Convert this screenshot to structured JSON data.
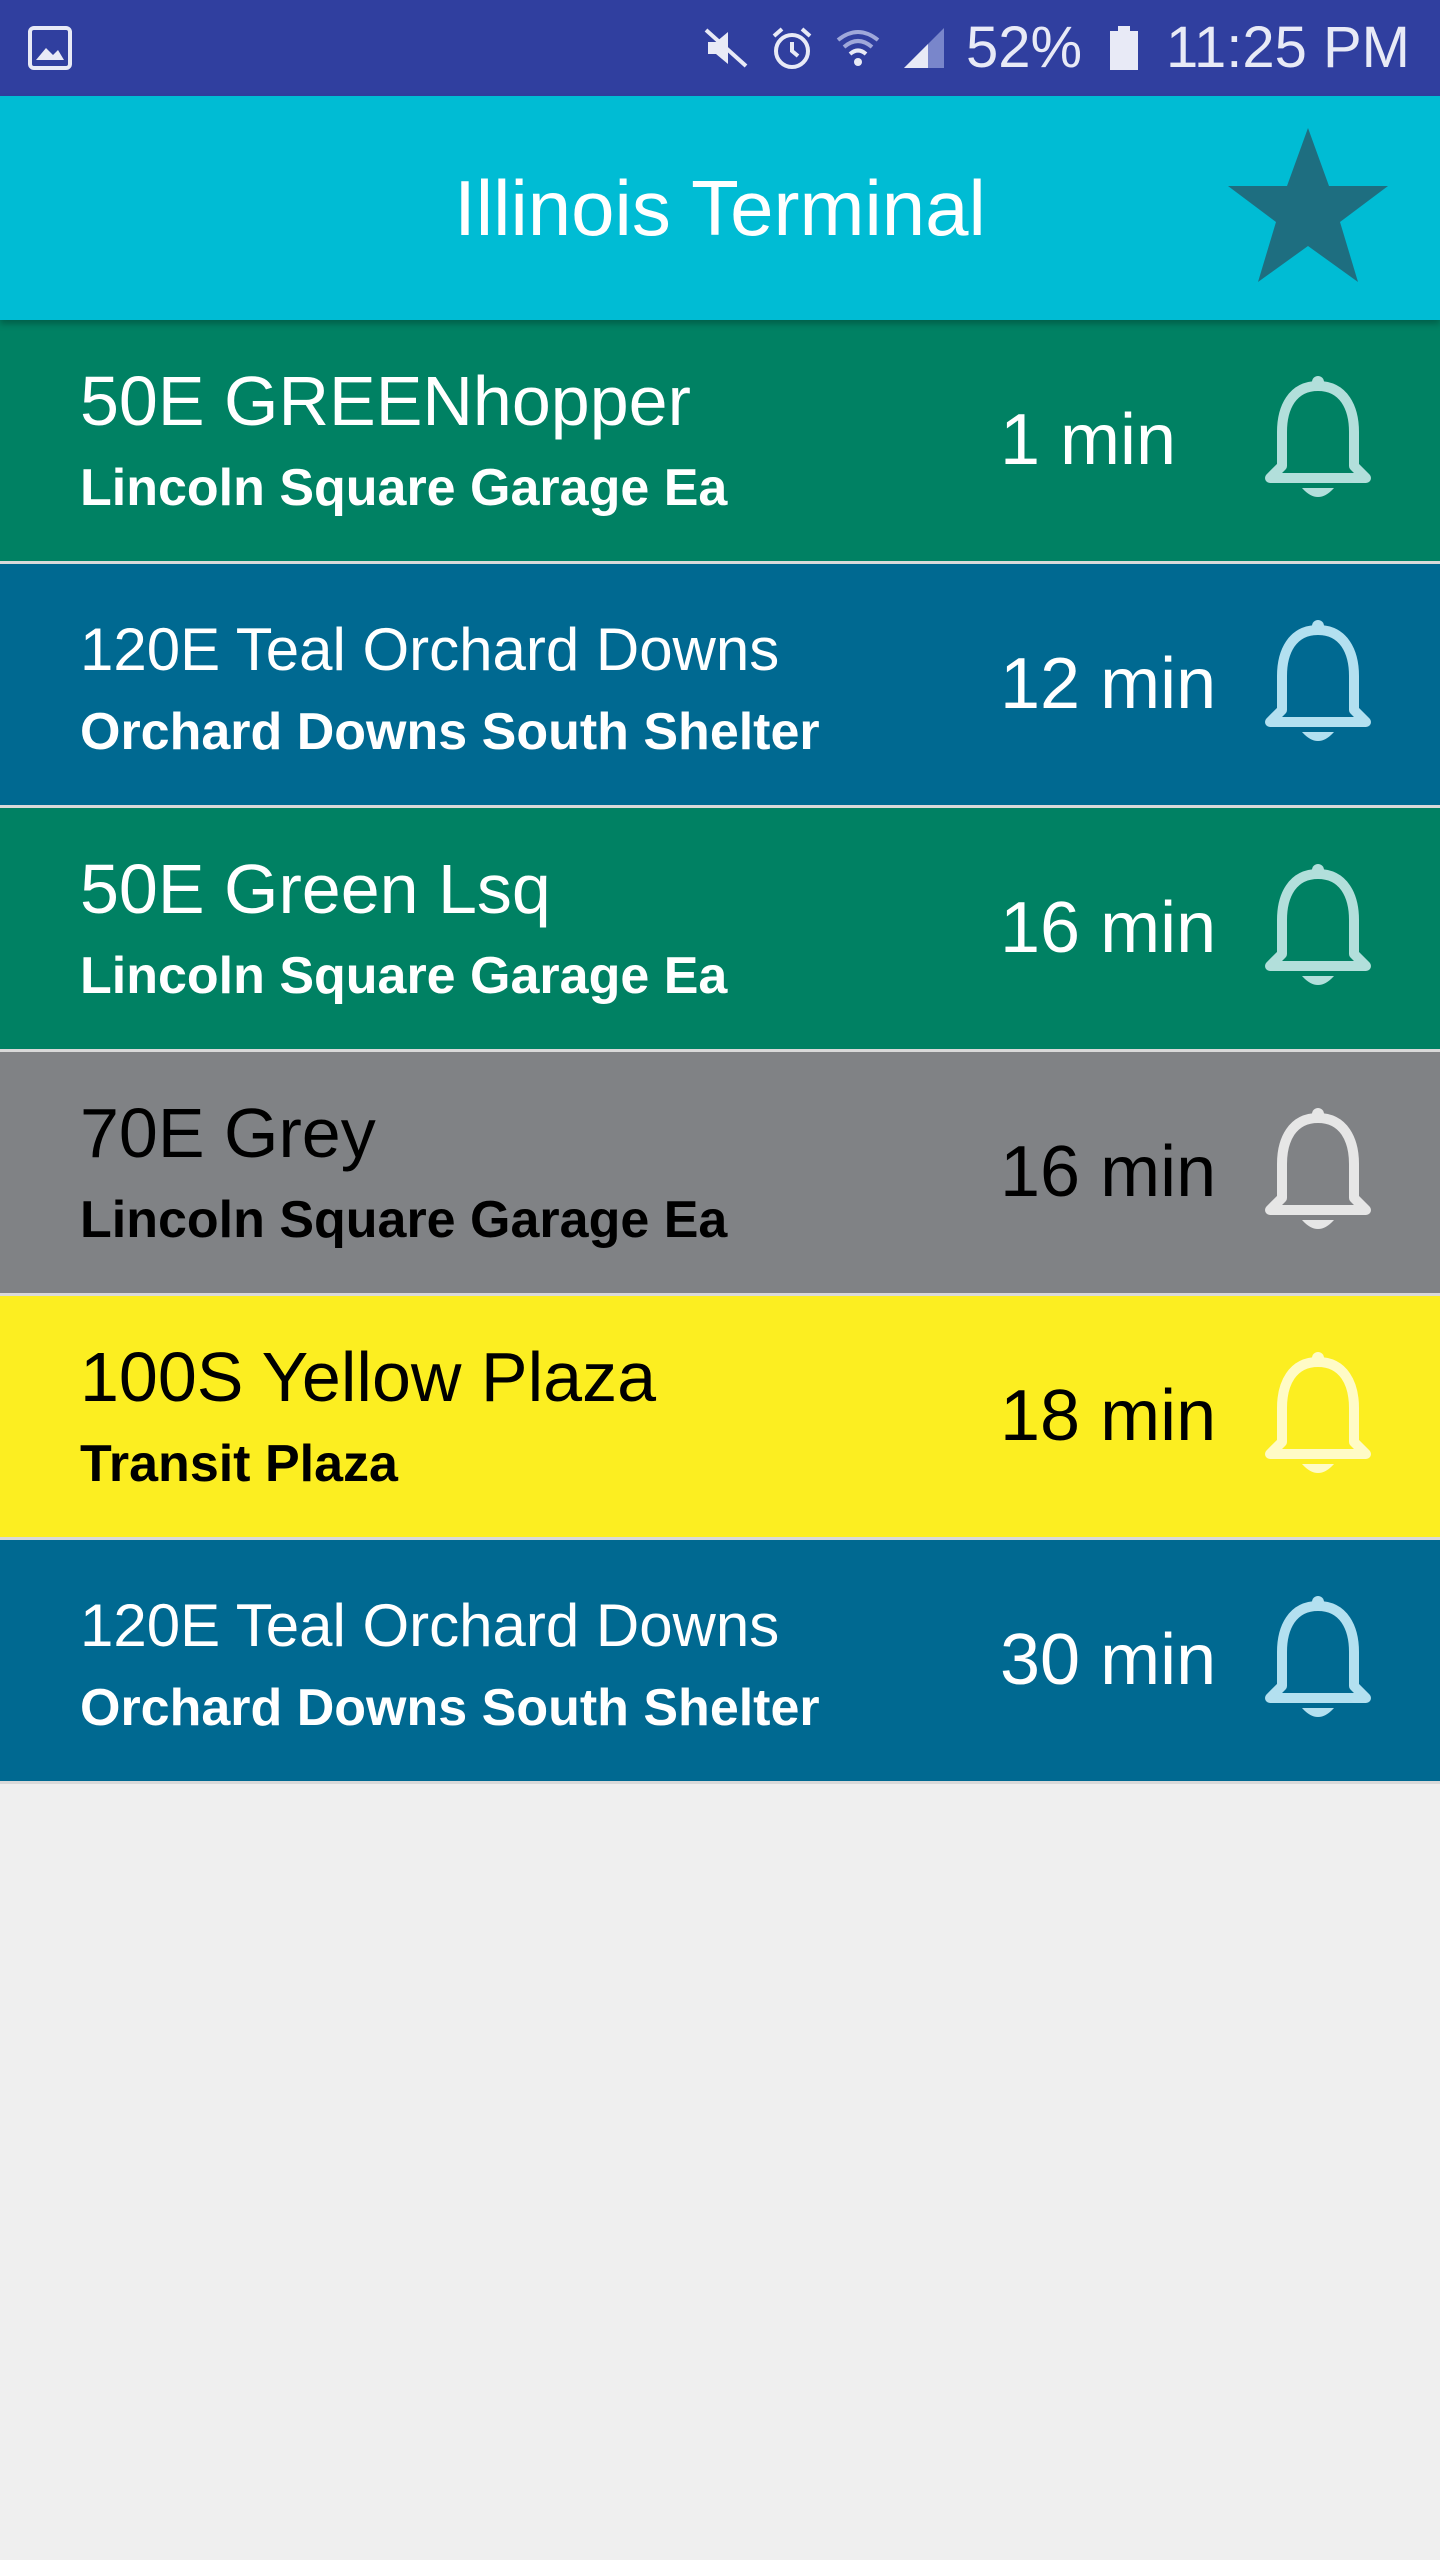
{
  "status_bar": {
    "left_icon": "gallery-notification-icon",
    "icons": [
      "mute-icon",
      "alarm-icon",
      "wifi-icon",
      "signal-icon"
    ],
    "battery": "52%",
    "time": "11:25 PM"
  },
  "header": {
    "title": "Illinois Terminal",
    "favorite_icon": "star-icon"
  },
  "departures": [
    {
      "route": "50E GREENhopper",
      "stop": "Lincoln Square Garage Ea",
      "time": "1 min",
      "bg": "#008163",
      "text_color": "#ffffff",
      "bell_color": "#b2dfdb"
    },
    {
      "route": "120E Teal Orchard Downs",
      "stop": "Orchard Downs South Shelter",
      "time": "12 min",
      "bg": "#006991",
      "text_color": "#ffffff",
      "bell_color": "#b3e0f0"
    },
    {
      "route": "50E Green Lsq",
      "stop": "Lincoln Square Garage Ea",
      "time": "16 min",
      "bg": "#008163",
      "text_color": "#ffffff",
      "bell_color": "#b2dfdb"
    },
    {
      "route": "70E Grey",
      "stop": "Lincoln Square Garage Ea",
      "time": "16 min",
      "bg": "#808285",
      "text_color": "#000000",
      "bell_color": "#e6e6e6"
    },
    {
      "route": "100S Yellow Plaza",
      "stop": "Transit Plaza",
      "time": "18 min",
      "bg": "#fcee21",
      "text_color": "#000000",
      "bell_color": "#fffbc6"
    },
    {
      "route": "120E Teal Orchard Downs",
      "stop": "Orchard Downs South Shelter",
      "time": "30 min",
      "bg": "#006991",
      "text_color": "#ffffff",
      "bell_color": "#b3e0f0"
    }
  ]
}
